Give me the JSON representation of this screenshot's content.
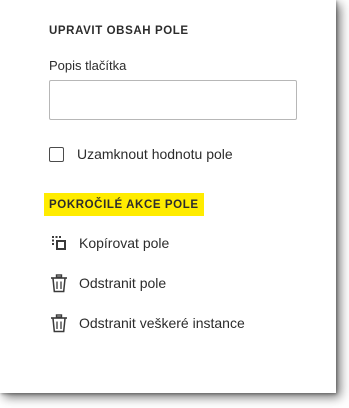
{
  "panel": {
    "section_title": "UPRAVIT OBSAH POLE",
    "field_label": "Popis tlačítka",
    "field_value": "",
    "lock_label": "Uzamknout hodnotu pole",
    "lock_checked": false
  },
  "advanced": {
    "title": "POKROČILÉ AKCE POLE",
    "highlight_color": "#ffec00",
    "actions": [
      {
        "label": "Kopírovat pole",
        "icon": "copy-field-icon"
      },
      {
        "label": "Odstranit pole",
        "icon": "trash-icon"
      },
      {
        "label": "Odstranit veškeré instance",
        "icon": "trash-icon"
      }
    ]
  }
}
